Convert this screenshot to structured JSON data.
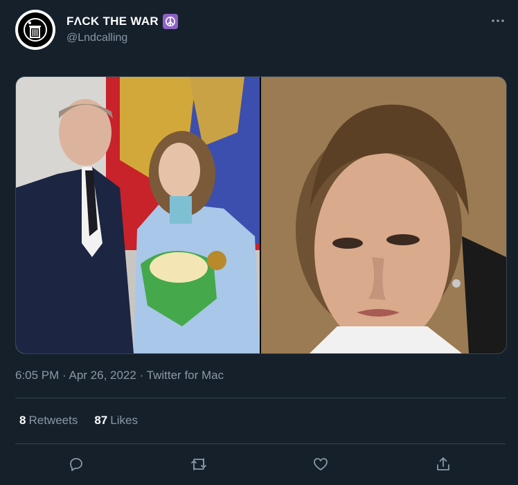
{
  "author": {
    "display_name": "FɅCK THE WAR",
    "handle": "@Lndcalling",
    "avatar_icon": "trash-can-icon",
    "badge_icon": "peace-symbol-icon"
  },
  "menu_icon": "more-dots-icon",
  "media": {
    "left_photo": "photo",
    "right_photo": "photo"
  },
  "timestamp": {
    "time": "6:05 PM",
    "dot1": " · ",
    "date": "Apr 26, 2022",
    "dot2": " · ",
    "source": "Twitter for Mac"
  },
  "stats": {
    "retweets_count": "8",
    "retweets_label": "Retweets",
    "likes_count": "87",
    "likes_label": "Likes"
  },
  "actions": [
    "reply-icon",
    "retweet-icon",
    "like-icon",
    "share-icon"
  ],
  "colors": {
    "background": "#15202b",
    "secondary_text": "#8b98a5",
    "divider": "#38444d",
    "badge": "#8e62c5"
  }
}
